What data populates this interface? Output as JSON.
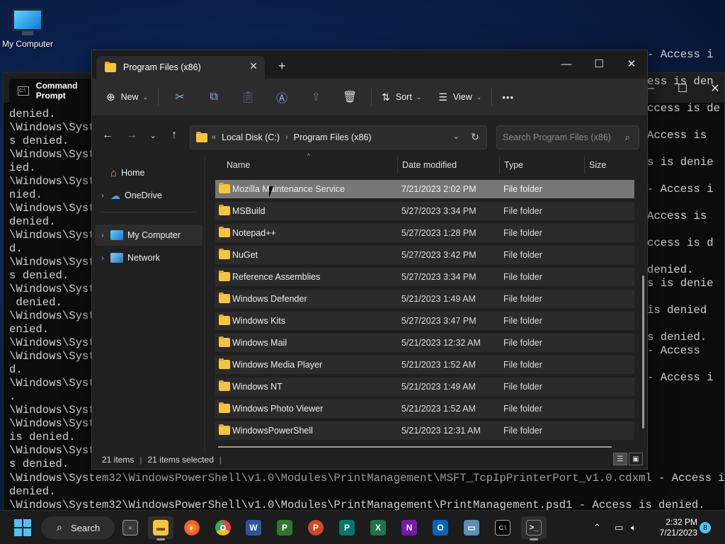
{
  "desktop": {
    "icon_label": "My Computer"
  },
  "cmd": {
    "tab_title": "Command Prompt",
    "left_lines": [
      "denied.",
      "\\Windows\\Syste",
      "s denied.",
      "\\Windows\\Syste",
      "ied.",
      "\\Windows\\Syste",
      "nied.",
      "\\Windows\\Syste",
      "denied.",
      "\\Windows\\Syste",
      "d.",
      "\\Windows\\Syste",
      "s denied.",
      "\\Windows\\Syste",
      " denied.",
      "\\Windows\\Syste",
      "enied.",
      "\\Windows\\Syste",
      "\\Windows\\Syste",
      "d.",
      "\\Windows\\Syste",
      ".",
      "\\Windows\\Syste",
      "\\Windows\\Syste",
      "is denied.",
      "\\Windows\\Syste",
      "s denied."
    ],
    "right_lines": [
      "- Access i",
      "",
      "ess is den",
      "",
      "ccess is de",
      "",
      "Access is",
      "",
      "s is denie",
      "",
      "- Access i",
      "",
      "Access is",
      "",
      "ccess is d",
      "",
      "denied.",
      "s is denie",
      "",
      "is denied",
      "",
      "s denied.",
      "- Access",
      "",
      "- Access i"
    ],
    "bottom_lines": [
      "\\Windows\\System32\\WindowsPowerShell\\v1.0\\Modules\\PrintManagement\\MSFT_TcpIpPrinterPort_v1.0.cdxml - Access is",
      "denied.",
      "\\Windows\\System32\\WindowsPowerShell\\v1.0\\Modules\\PrintManagement\\PrintManagement.psd1 - Access is denied."
    ]
  },
  "explorer": {
    "tab_title": "Program Files (x86)",
    "toolbar": {
      "new_label": "New",
      "sort_label": "Sort",
      "view_label": "View",
      "more_label": "•••"
    },
    "address": {
      "overflow": "«",
      "crumbs": [
        "Local Disk (C:)",
        "Program Files (x86)"
      ]
    },
    "search": {
      "placeholder": "Search Program Files (x86)"
    },
    "nav": {
      "home": "Home",
      "onedrive": "OneDrive",
      "mycomputer": "My Computer",
      "network": "Network"
    },
    "columns": {
      "name": "Name",
      "date": "Date modified",
      "type": "Type",
      "size": "Size"
    },
    "files": [
      {
        "name": "Mozilla Maintenance Service",
        "date": "7/21/2023 2:02 PM",
        "type": "File folder"
      },
      {
        "name": "MSBuild",
        "date": "5/27/2023 3:34 PM",
        "type": "File folder"
      },
      {
        "name": "Notepad++",
        "date": "5/27/2023 1:28 PM",
        "type": "File folder"
      },
      {
        "name": "NuGet",
        "date": "5/27/2023 3:42 PM",
        "type": "File folder"
      },
      {
        "name": "Reference Assemblies",
        "date": "5/27/2023 3:34 PM",
        "type": "File folder"
      },
      {
        "name": "Windows Defender",
        "date": "5/21/2023 1:49 AM",
        "type": "File folder"
      },
      {
        "name": "Windows Kits",
        "date": "5/27/2023 3:47 PM",
        "type": "File folder"
      },
      {
        "name": "Windows Mail",
        "date": "5/21/2023 12:32 AM",
        "type": "File folder"
      },
      {
        "name": "Windows Media Player",
        "date": "5/21/2023 1:52 AM",
        "type": "File folder"
      },
      {
        "name": "Windows NT",
        "date": "5/21/2023 1:49 AM",
        "type": "File folder"
      },
      {
        "name": "Windows Photo Viewer",
        "date": "5/21/2023 1:52 AM",
        "type": "File folder"
      },
      {
        "name": "WindowsPowerShell",
        "date": "5/21/2023 12:31 AM",
        "type": "File folder"
      }
    ],
    "status": {
      "count": "21 items",
      "selected": "21 items selected"
    }
  },
  "taskbar": {
    "search_label": "Search",
    "time": "2:32 PM",
    "date": "7/21/2023",
    "notification_count": "8"
  },
  "colors": {
    "accent": "#4cc2ff",
    "folder": "#f5c542",
    "selected_row": "#777777"
  }
}
